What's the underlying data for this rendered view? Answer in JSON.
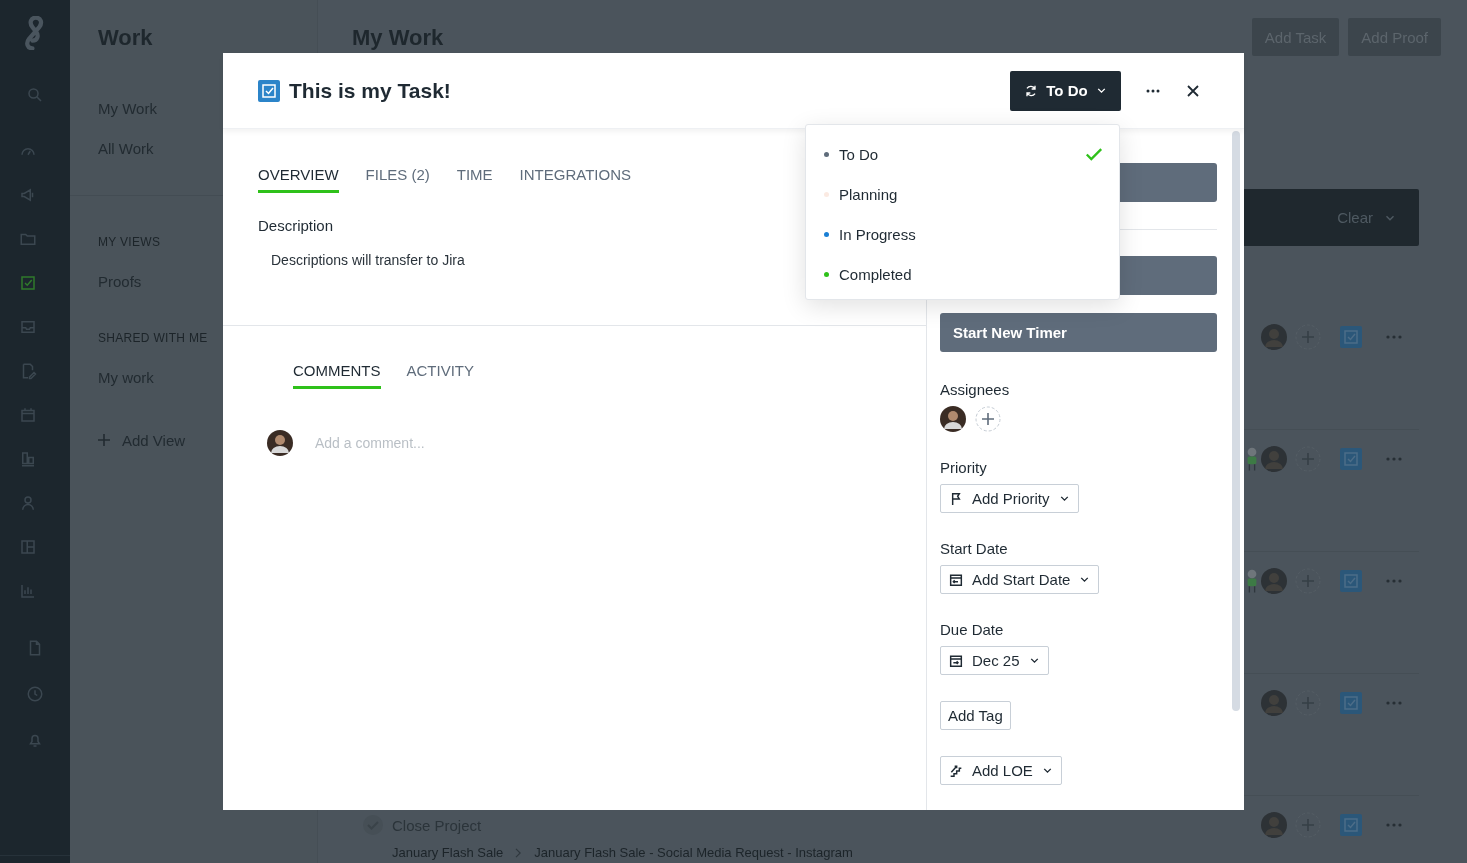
{
  "rail": {
    "top": [
      {
        "kind": "search",
        "selected": false
      }
    ],
    "main": [
      {
        "kind": "gauge",
        "selected": false
      },
      {
        "kind": "megaphone",
        "selected": false
      },
      {
        "kind": "folder",
        "selected": false
      },
      {
        "kind": "checkbox",
        "selected": true
      },
      {
        "kind": "tray",
        "selected": false
      },
      {
        "kind": "pen",
        "selected": false
      },
      {
        "kind": "calendar",
        "selected": false
      },
      {
        "kind": "columns",
        "selected": false
      },
      {
        "kind": "person",
        "selected": false
      },
      {
        "kind": "layout",
        "selected": false
      },
      {
        "kind": "chart",
        "selected": false
      }
    ],
    "bottom": [
      {
        "kind": "document",
        "selected": false
      },
      {
        "kind": "clock",
        "selected": false
      },
      {
        "kind": "bell",
        "selected": false
      }
    ]
  },
  "sidebar": {
    "title": "Work",
    "items": [
      "My Work",
      "All Work"
    ],
    "sections": [
      {
        "heading": "MY VIEWS",
        "items": [
          "Proofs"
        ]
      },
      {
        "heading": "SHARED WITH ME",
        "items": [
          "My work"
        ]
      }
    ],
    "add_view": "Add View"
  },
  "main": {
    "title": "My Work",
    "buttons": [
      "Add Task",
      "Add Proof"
    ],
    "filter": "Clear",
    "rows": [
      {
        "extra_figure": false
      },
      {
        "extra_figure": true
      },
      {
        "extra_figure": true
      },
      {
        "extra_figure": false
      },
      {
        "extra_figure": false,
        "title": "Close Project",
        "breadcrumb": [
          "January Flash Sale",
          "January Flash Sale - Social Media Request - Instagram"
        ]
      }
    ]
  },
  "modal": {
    "title": "This is my Task!",
    "status": "To Do",
    "tabs": [
      {
        "label": "OVERVIEW",
        "selected": true
      },
      {
        "label": "FILES (2)",
        "selected": false
      },
      {
        "label": "TIME",
        "selected": false
      },
      {
        "label": "INTEGRATIONS",
        "selected": false
      }
    ],
    "description": {
      "label": "Description",
      "text": "Descriptions will transfer to Jira"
    },
    "comment_tabs": [
      {
        "label": "COMMENTS",
        "selected": true
      },
      {
        "label": "ACTIVITY",
        "selected": false
      }
    ],
    "comment_placeholder": "Add a comment...",
    "status_menu": [
      {
        "label": "To Do",
        "color": "#5f6c7b",
        "selected": true
      },
      {
        "label": "Planning",
        "color": "#fbeae2",
        "selected": false
      },
      {
        "label": "In Progress",
        "color": "#1a7fd4",
        "selected": false
      },
      {
        "label": "Completed",
        "color": "#2fc11a",
        "selected": false
      }
    ],
    "timer": "Start New Timer",
    "fields": [
      {
        "kind": "assignees",
        "label": "Assignees"
      },
      {
        "kind": "priority",
        "label": "Priority",
        "value": "Add Priority"
      },
      {
        "kind": "start-date",
        "label": "Start Date",
        "value": "Add Start Date"
      },
      {
        "kind": "due-date",
        "label": "Due Date",
        "value": "Dec 25"
      },
      {
        "kind": "tag",
        "value": "Add Tag"
      },
      {
        "kind": "loe",
        "value": "Add LOE"
      }
    ]
  }
}
